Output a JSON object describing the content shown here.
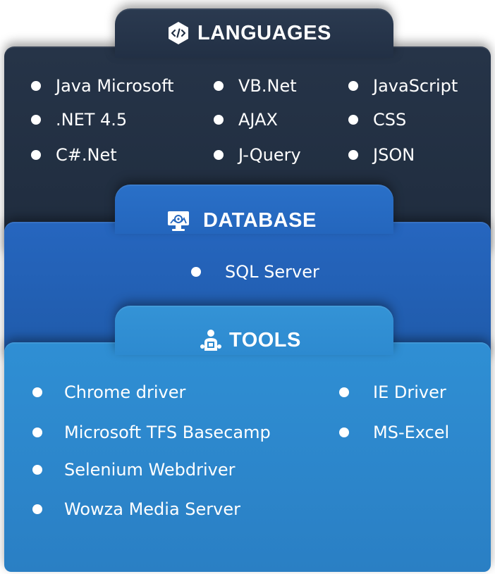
{
  "languages": {
    "title": "LANGUAGES",
    "icon": "code-icon",
    "items": [
      "Java Microsoft",
      "VB.Net",
      "JavaScript",
      ".NET 4.5",
      "AJAX",
      "CSS",
      "C#.Net",
      "J-Query",
      "JSON"
    ]
  },
  "database": {
    "title": "DATABASE",
    "icon": "database-monitor-icon",
    "items": [
      "SQL Server"
    ]
  },
  "tools": {
    "title": "TOOLS",
    "icon": "tools-person-icon",
    "items": [
      "Chrome driver",
      "IE Driver",
      "Microsoft TFS Basecamp",
      "MS-Excel",
      "Selenium Webdriver",
      "Wowza Media Server"
    ]
  },
  "colors": {
    "languages_bg": "#223045",
    "database_bg": "#2466bd",
    "tools_bg": "#2d8ad0",
    "text": "#ffffff"
  }
}
